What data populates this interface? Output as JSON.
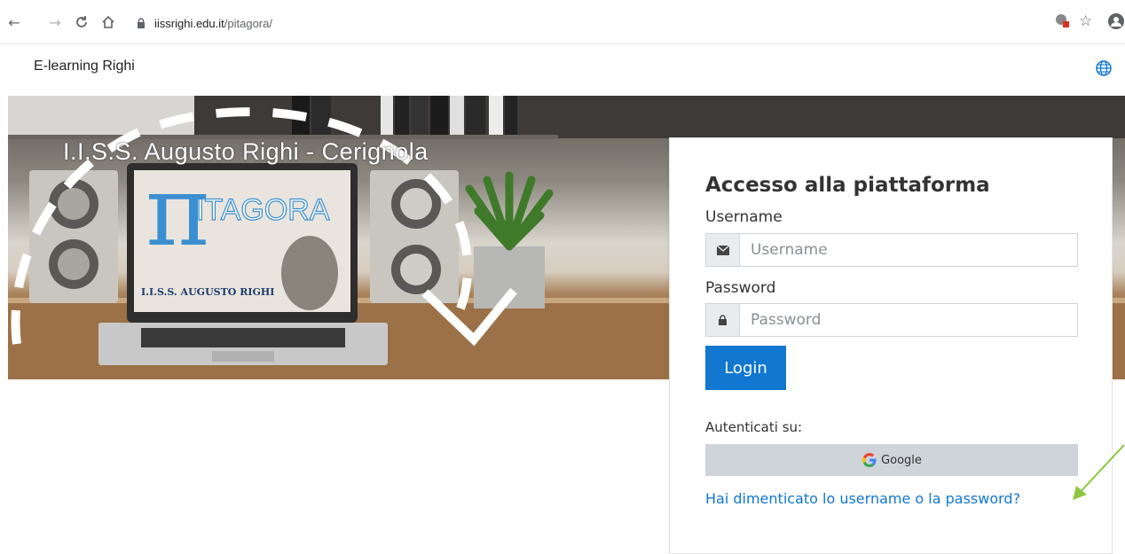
{
  "browser": {
    "url_host": "iissrighi.edu.it",
    "url_path": "/pitagora/"
  },
  "site": {
    "name": "E-learning Righi"
  },
  "hero": {
    "title": "I.I.S.S. Augusto Righi - Cerignola",
    "laptop_logo": "ITAGORA",
    "laptop_school": "I.I.S.S. AUGUSTO RIGHI"
  },
  "login": {
    "title": "Accesso alla piattaforma",
    "username_label": "Username",
    "username_placeholder": "Username",
    "password_label": "Password",
    "password_placeholder": "Password",
    "login_button": "Login",
    "auth_label": "Autenticati su:",
    "google_label": "Google",
    "forgot_link": "Hai dimenticato lo username o la password?"
  },
  "colors": {
    "primary": "#1177d1",
    "google_button_bg": "#ced4da",
    "annotation_arrow": "#8cc63f"
  }
}
